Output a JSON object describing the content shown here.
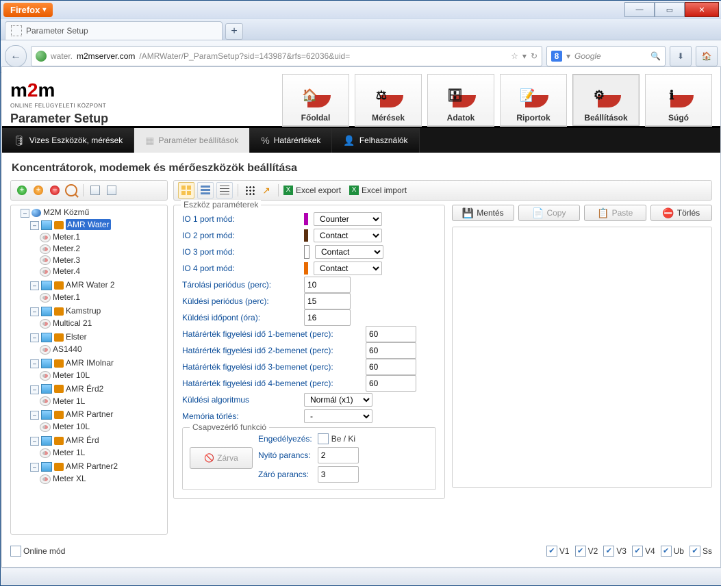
{
  "window": {
    "browser_label": "Firefox",
    "tab_title": "Parameter Setup",
    "url_prefix": "water.",
    "url_host": "m2mserver.com",
    "url_path": "/AMRWater/P_ParamSetup?sid=143987&rfs=62036&uid=",
    "search_placeholder": "Google"
  },
  "header": {
    "logo_text_left": "m",
    "logo_text_mid": "2",
    "logo_text_right": "m",
    "logo_caption": "ONLINE FELÜGYELETI KÖZPONT",
    "page_title": "Parameter Setup",
    "nav": [
      {
        "label": "Főoldal",
        "glyph": "🏠"
      },
      {
        "label": "Mérések",
        "glyph": "⚖"
      },
      {
        "label": "Adatok",
        "glyph": "🗄"
      },
      {
        "label": "Riportok",
        "glyph": "📝"
      },
      {
        "label": "Beállítások",
        "glyph": "⚙",
        "active": true
      },
      {
        "label": "Súgó",
        "glyph": "ℹ"
      }
    ]
  },
  "subnav": [
    {
      "label": "Vizes Eszközök, mérések",
      "glyph": "🛢"
    },
    {
      "label": "Paraméter beállítások",
      "glyph": "▦",
      "active": true
    },
    {
      "label": "Határértékek",
      "glyph": "%"
    },
    {
      "label": "Felhasználók",
      "glyph": "👤"
    }
  ],
  "section_title": "Koncentrátorok, modemek és mérőeszközök beállítása",
  "toolbar_right": {
    "excel_export": "Excel export",
    "excel_import": "Excel import"
  },
  "tree": {
    "root": "M2M Közmű",
    "nodes": [
      {
        "label": "AMR Water",
        "selected": true,
        "children": [
          "Meter.1",
          "Meter.2",
          "Meter.3",
          "Meter.4"
        ]
      },
      {
        "label": "AMR Water 2",
        "children": [
          "Meter.1"
        ]
      },
      {
        "label": "Kamstrup",
        "children": [
          "Multical 21"
        ]
      },
      {
        "label": "Elster",
        "children": [
          "AS1440"
        ]
      },
      {
        "label": "AMR IMolnar",
        "children": [
          "Meter 10L"
        ]
      },
      {
        "label": "AMR Érd2",
        "children": [
          "Meter 1L"
        ]
      },
      {
        "label": "AMR Partner",
        "children": [
          "Meter 10L"
        ]
      },
      {
        "label": "AMR Érd",
        "children": [
          "Meter 1L"
        ]
      },
      {
        "label": "AMR Partner2",
        "children": [
          "Meter XL"
        ]
      }
    ]
  },
  "form": {
    "legend": "Eszköz paraméterek",
    "io": [
      {
        "label": "IO 1 port mód:",
        "color": "#b100b1",
        "value": "Counter"
      },
      {
        "label": "IO 2 port mód:",
        "color": "#5a2e0e",
        "value": "Contact"
      },
      {
        "label": "IO 3 port mód:",
        "color": "#ffffff",
        "value": "Contact",
        "border": "#888"
      },
      {
        "label": "IO 4 port mód:",
        "color": "#e86a00",
        "value": "Contact"
      }
    ],
    "storage_period": {
      "label": "Tárolási periódus (perc):",
      "value": "10"
    },
    "send_period": {
      "label": "Küldési periódus (perc):",
      "value": "15"
    },
    "send_time": {
      "label": "Küldési időpont (óra):",
      "value": "16"
    },
    "limits": [
      {
        "label": "Határérték figyelési idő 1-bemenet (perc):",
        "value": "60"
      },
      {
        "label": "Határérték figyelési idő 2-bemenet (perc):",
        "value": "60"
      },
      {
        "label": "Határérték figyelési idő 3-bemenet (perc):",
        "value": "60"
      },
      {
        "label": "Határérték figyelési idő 4-bemenet (perc):",
        "value": "60"
      }
    ],
    "send_alg": {
      "label": "Küldési algoritmus",
      "value": "Normál (x1)"
    },
    "mem_clear": {
      "label": "Memória törlés:",
      "value": "-"
    },
    "tap": {
      "legend": "Csapvezérlő funkció",
      "enable_label": "Engedélyezés:",
      "toggle_label": "Be / Ki",
      "open_label": "Nyitó parancs:",
      "open_value": "2",
      "close_label": "Záró parancs:",
      "close_value": "3",
      "status_btn": "Zárva"
    }
  },
  "actions": {
    "save": "Mentés",
    "copy": "Copy",
    "paste": "Paste",
    "delete": "Törlés"
  },
  "footer": {
    "online_mode": "Online mód",
    "checks": [
      "V1",
      "V2",
      "V3",
      "V4",
      "Ub",
      "Ss"
    ]
  }
}
